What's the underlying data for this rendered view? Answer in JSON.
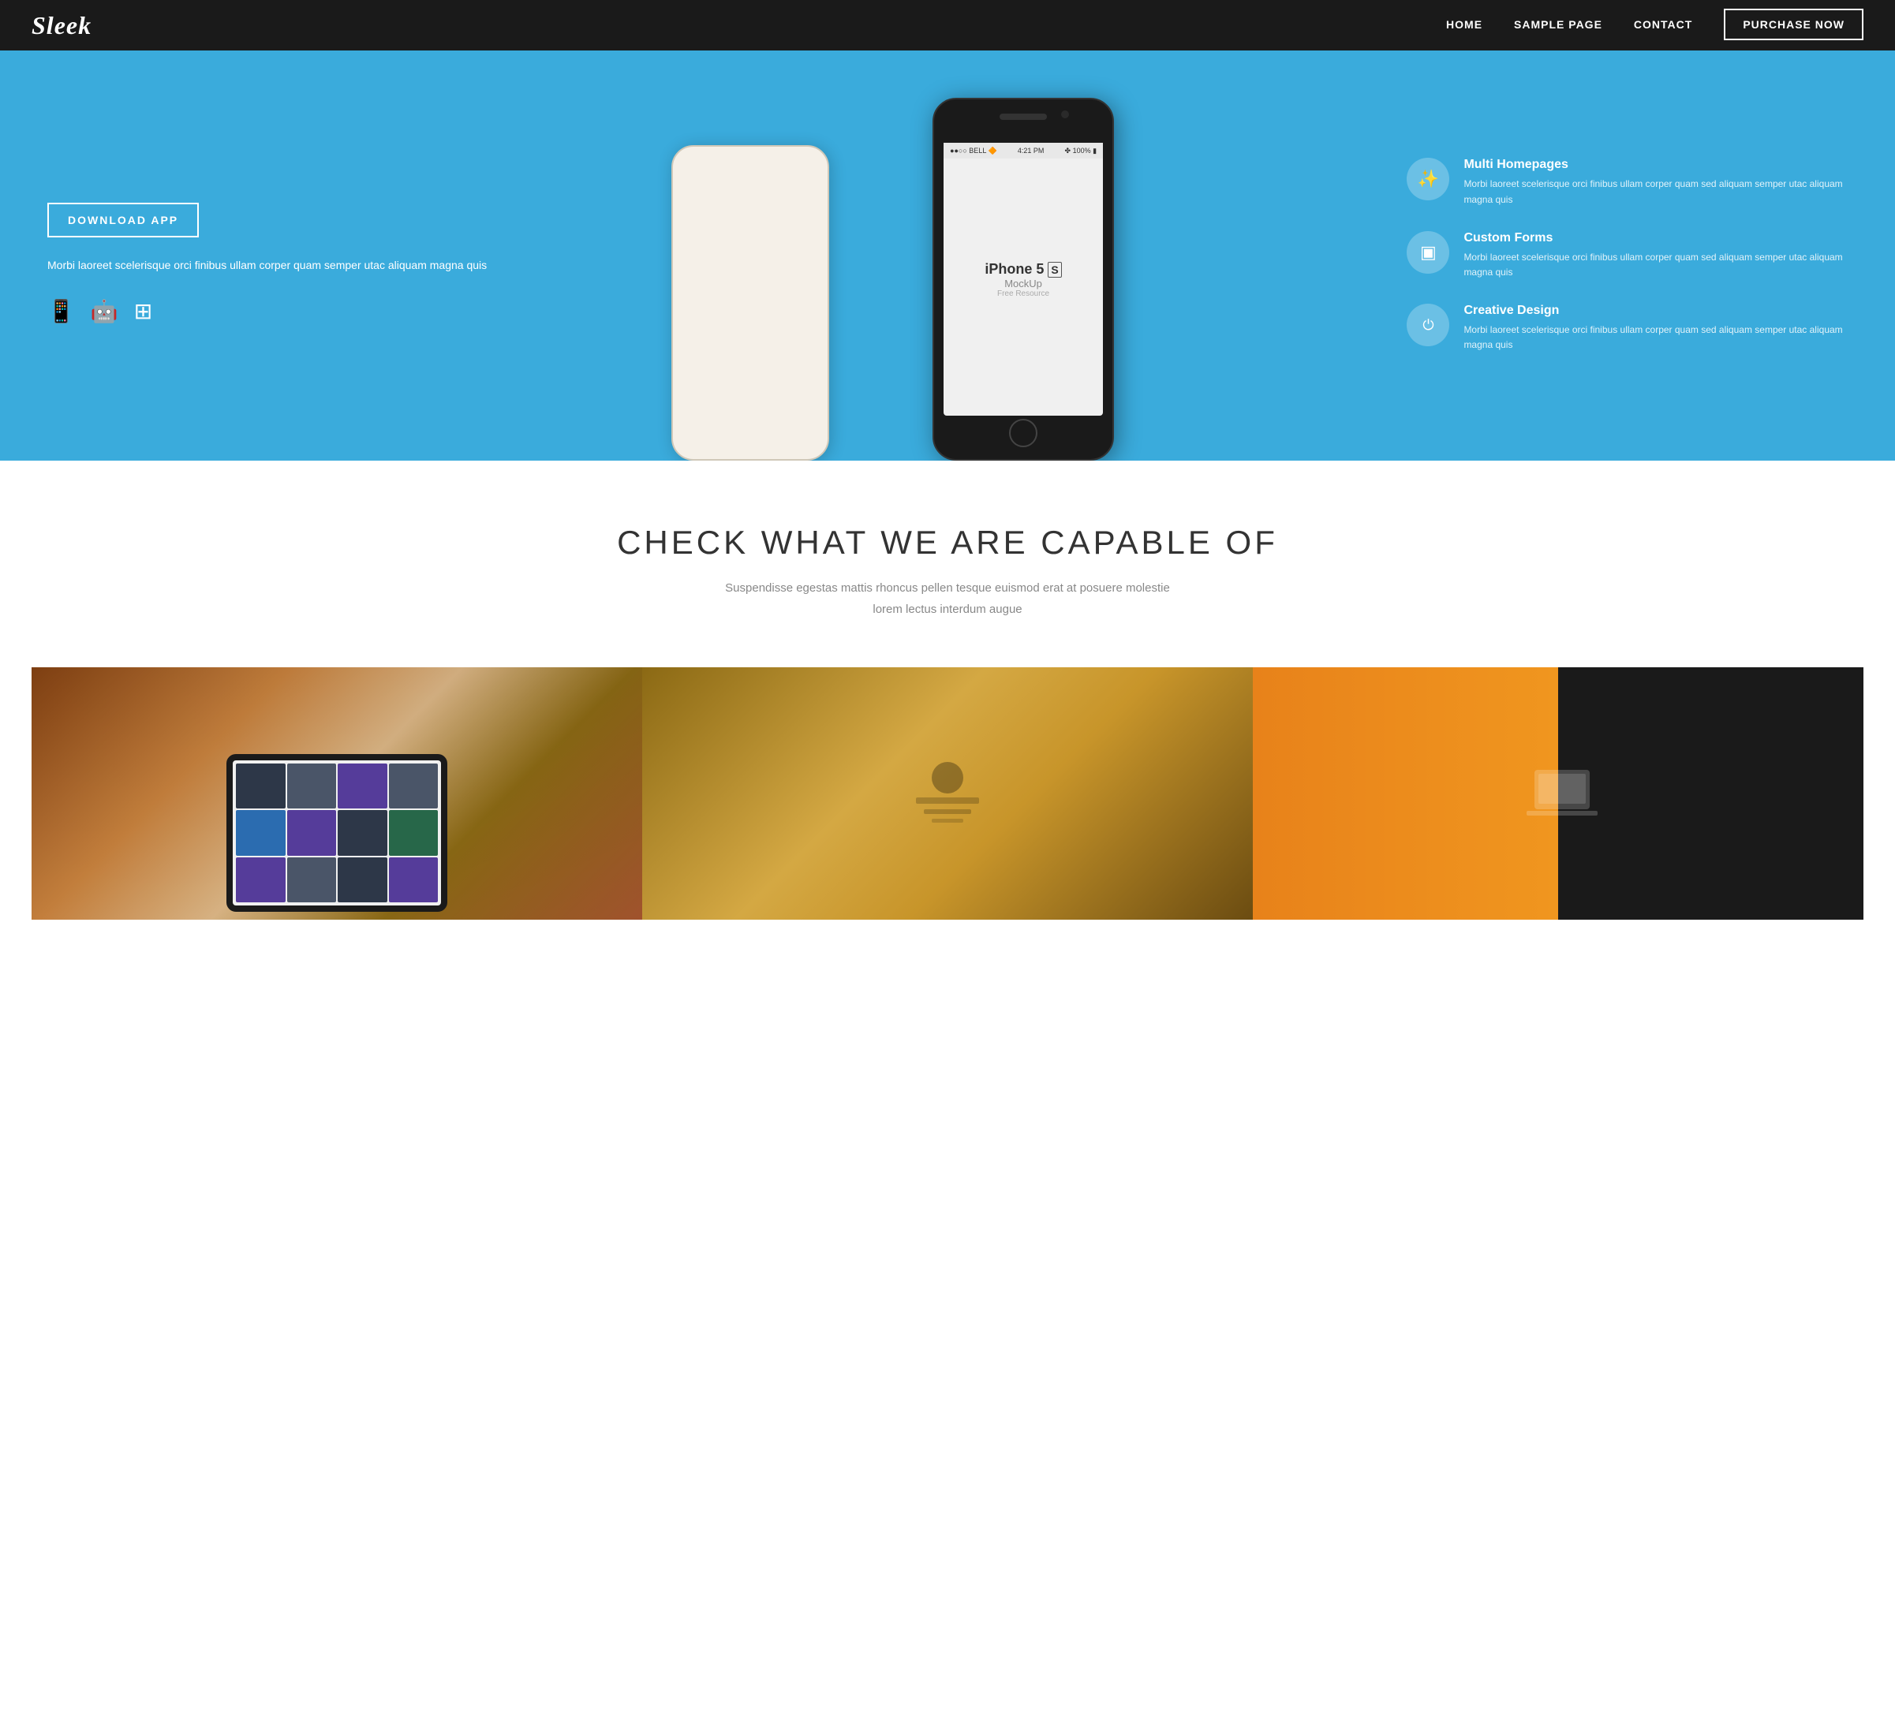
{
  "navbar": {
    "logo": "Sleek",
    "links": [
      {
        "id": "home",
        "label": "HOME"
      },
      {
        "id": "sample-page",
        "label": "SAMPLE PAGE"
      },
      {
        "id": "contact",
        "label": "CONTACT"
      }
    ],
    "purchase_button": "PURCHASE NOW"
  },
  "hero": {
    "download_button": "DOWNLOAD APP",
    "description": "Morbi laoreet scelerisque orci finibus ullam corper quam semper utac aliquam magna quis",
    "platforms": [
      "📱",
      "🤖",
      "⊞"
    ],
    "phone_text": "iPhone 5",
    "phone_sub": "MockUp",
    "phone_small": "Free Resource",
    "features": [
      {
        "id": "multi-homepages",
        "icon": "✨",
        "title": "Multi Homepages",
        "description": "Morbi laoreet scelerisque orci finibus ullam corper quam sed aliquam semper utac aliquam magna quis"
      },
      {
        "id": "custom-forms",
        "icon": "▣",
        "title": "Custom Forms",
        "description": "Morbi laoreet scelerisque orci finibus ullam corper quam sed aliquam semper utac aliquam magna quis"
      },
      {
        "id": "creative-design",
        "icon": "⊙",
        "title": "Creative Design",
        "description": "Morbi laoreet scelerisque orci finibus ullam corper quam sed aliquam semper utac aliquam magna quis"
      }
    ]
  },
  "capabilities": {
    "title": "CHECK WHAT WE ARE CAPABLE OF",
    "description": "Suspendisse egestas mattis rhoncus pellen tesque euismod erat at posuere molestie lorem lectus interdum augue"
  },
  "images": [
    {
      "id": "tablet",
      "alt": "Tablet with app grid"
    },
    {
      "id": "stationary",
      "alt": "Stationary and design items"
    },
    {
      "id": "laptop",
      "alt": "Person working with laptop"
    }
  ]
}
